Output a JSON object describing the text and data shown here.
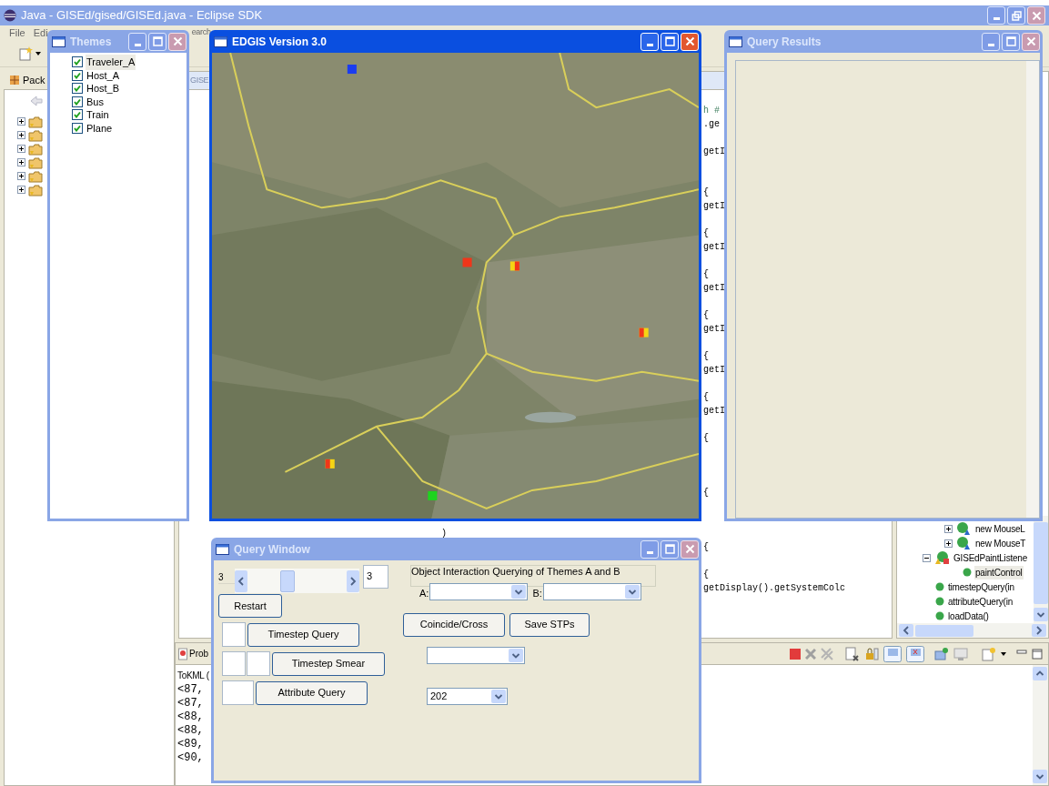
{
  "main_window": {
    "title": "Java - GISEd/gised/GISEd.java - Eclipse SDK",
    "active": false,
    "menu": [
      {
        "label": "File"
      },
      {
        "label": "Edi"
      },
      {
        "label": "earch"
      }
    ]
  },
  "package_explorer": {
    "tab": "Pack",
    "items": [
      {
        "expanded": false
      },
      {
        "expanded": false
      },
      {
        "expanded": false
      },
      {
        "expanded": false
      },
      {
        "expanded": false
      },
      {
        "expanded": false
      }
    ]
  },
  "editor": {
    "tab": "GISE",
    "code": [
      {
        "text": "h #",
        "kind": "comment"
      },
      {
        "text": ".ge",
        "kind": "code"
      },
      {
        "text": "getI",
        "kind": "code"
      },
      {
        "text": "{",
        "kind": "code"
      },
      {
        "text": "getI",
        "kind": "code"
      },
      {
        "text": "{",
        "kind": "code"
      },
      {
        "text": "getI",
        "kind": "code"
      },
      {
        "text": "{",
        "kind": "code"
      },
      {
        "text": "getI",
        "kind": "code"
      },
      {
        "text": "{",
        "kind": "code"
      },
      {
        "text": "getI",
        "kind": "code"
      },
      {
        "text": "{",
        "kind": "code"
      },
      {
        "text": "getI",
        "kind": "code"
      },
      {
        "text": "{",
        "kind": "code"
      },
      {
        "text": "getI",
        "kind": "code"
      },
      {
        "text": "{",
        "kind": "code"
      },
      {
        "text": "{",
        "kind": "code"
      },
      {
        "text": ")",
        "kind": "code"
      },
      {
        "text": "{",
        "kind": "code"
      },
      {
        "text": "{",
        "kind": "code"
      },
      {
        "text": "getDisplay().getSystemColc",
        "kind": "code"
      }
    ]
  },
  "outline": {
    "items": [
      {
        "label": "new MouseL",
        "kind": "anonymous",
        "expanded": false,
        "selected": false
      },
      {
        "label": "new MouseT",
        "kind": "anonymous",
        "expanded": false,
        "selected": false
      },
      {
        "label": "GISEdPaintListene",
        "kind": "class",
        "expanded": true,
        "selected": false,
        "children": [
          {
            "label": "paintControl",
            "kind": "method",
            "selected": true
          }
        ]
      },
      {
        "label": "timestepQuery(in",
        "kind": "method",
        "selected": false
      },
      {
        "label": "attributeQuery(in",
        "kind": "method",
        "selected": false
      },
      {
        "label": "loadData()",
        "kind": "method",
        "selected": false
      }
    ]
  },
  "console": {
    "tab": "Prob",
    "header": "ToKML (",
    "lines": [
      "<87,",
      "<87,",
      "<88,",
      "<88,",
      "<89,",
      "<90,"
    ]
  },
  "themes_window": {
    "title": "Themes",
    "active": false,
    "layers": [
      {
        "label": "Traveler_A",
        "checked": true,
        "selected": true
      },
      {
        "label": "Host_A",
        "checked": true,
        "selected": false
      },
      {
        "label": "Host_B",
        "checked": true,
        "selected": false
      },
      {
        "label": "Bus",
        "checked": true,
        "selected": false
      },
      {
        "label": "Train",
        "checked": true,
        "selected": false
      },
      {
        "label": "Plane",
        "checked": true,
        "selected": false
      }
    ]
  },
  "map_window": {
    "title": "EDGIS Version 3.0",
    "active": true
  },
  "results_window": {
    "title": "Query Results",
    "active": false
  },
  "query_window": {
    "title": "Query Window",
    "active": false,
    "time_label": "3",
    "time_slider": {
      "level": 0.4
    },
    "time_field": "3",
    "restart": "Restart",
    "timestep_query": "Timestep Query",
    "timestep_smear": "Timestep Smear",
    "attribute_query": "Attribute Query",
    "group_title": "Object Interaction Querying of Themes A and B",
    "a_label": "A:",
    "b_label": "B:",
    "coincide": "Coincide/Cross",
    "save": "Save STPs",
    "id_value": "202"
  }
}
